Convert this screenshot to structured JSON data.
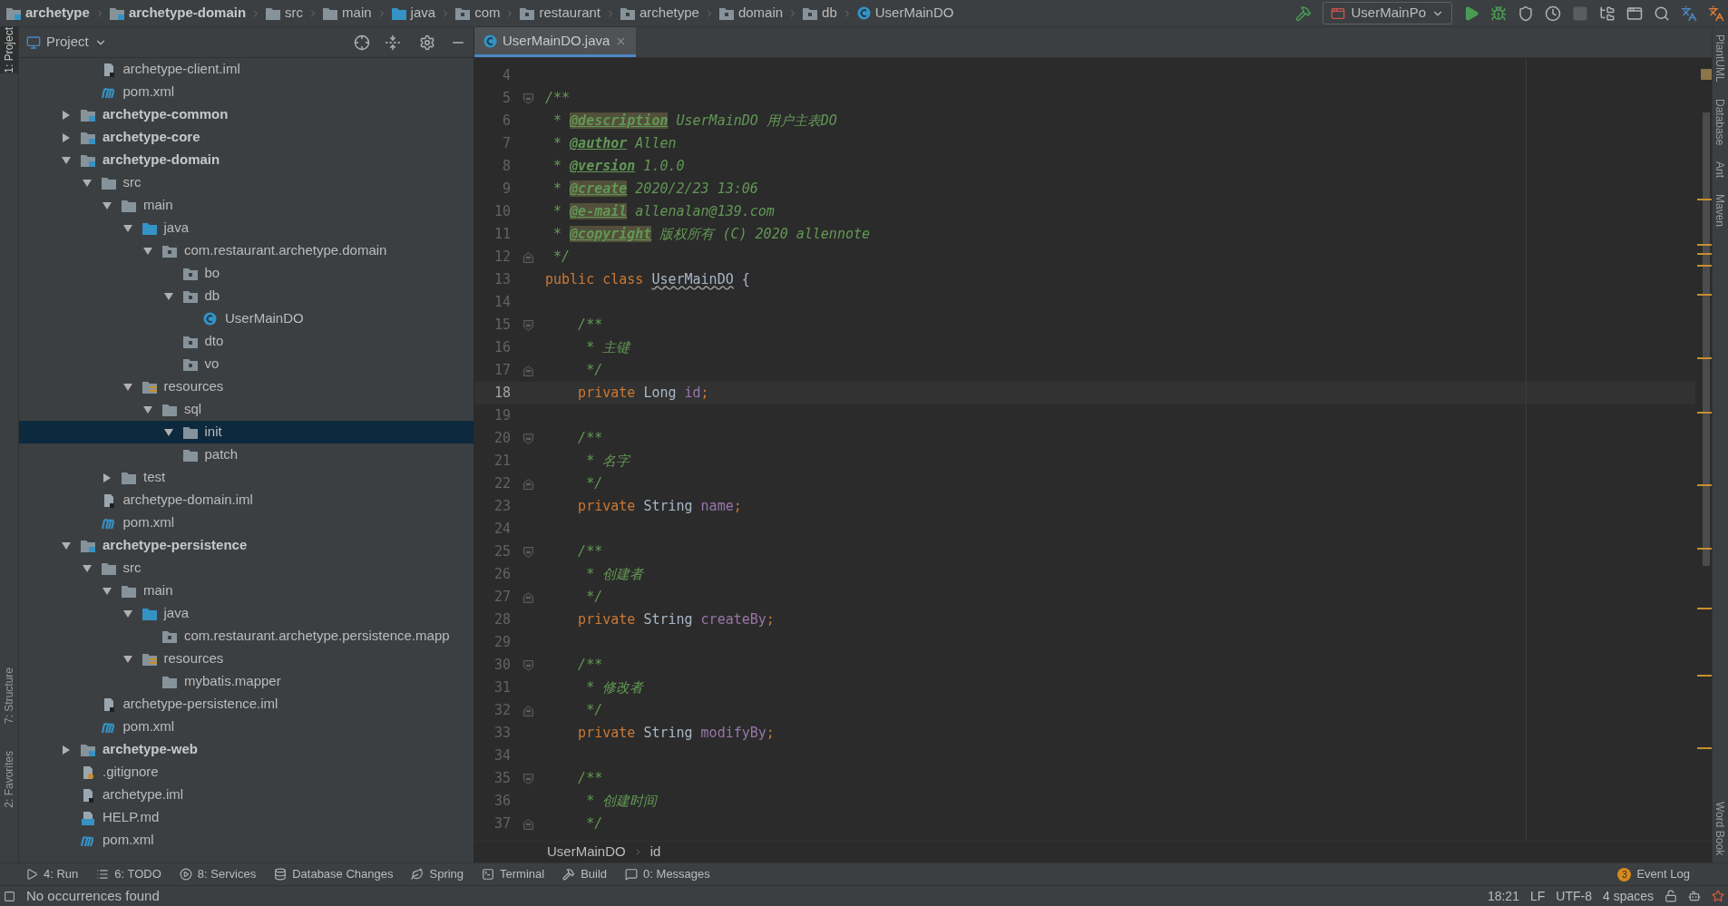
{
  "navbar": {
    "breadcrumbs": [
      {
        "label": "archetype",
        "kind": "module"
      },
      {
        "label": "archetype-domain",
        "kind": "module"
      },
      {
        "label": "src",
        "kind": "folder"
      },
      {
        "label": "main",
        "kind": "folder"
      },
      {
        "label": "java",
        "kind": "source"
      },
      {
        "label": "com",
        "kind": "package"
      },
      {
        "label": "restaurant",
        "kind": "package"
      },
      {
        "label": "archetype",
        "kind": "package"
      },
      {
        "label": "domain",
        "kind": "package"
      },
      {
        "label": "db",
        "kind": "package"
      },
      {
        "label": "UserMainDO",
        "kind": "class"
      }
    ],
    "run_config": "UserMainPo"
  },
  "left_tool_tabs": [
    {
      "label": "1: Project",
      "selected": true
    },
    {
      "label": "7: Structure",
      "selected": false
    },
    {
      "label": "2: Favorites",
      "selected": false
    }
  ],
  "right_tool_tabs": [
    "PlantUML",
    "Database",
    "Ant",
    "Maven",
    "Word Book"
  ],
  "project_panel": {
    "title": "Project",
    "tree": {
      "continued": [
        {
          "label": "archetype-client.iml",
          "kind": "iml"
        },
        {
          "label": "pom.xml",
          "kind": "maven"
        }
      ],
      "items": [
        {
          "label": "archetype-common",
          "kind": "module",
          "expanded": false
        },
        {
          "label": "archetype-core",
          "kind": "module",
          "expanded": false
        },
        {
          "label": "archetype-domain",
          "kind": "module",
          "expanded": true,
          "children": [
            {
              "label": "src",
              "kind": "folder",
              "expanded": true,
              "children": [
                {
                  "label": "main",
                  "kind": "folder",
                  "expanded": true,
                  "children": [
                    {
                      "label": "java",
                      "kind": "source",
                      "expanded": true,
                      "children": [
                        {
                          "label": "com.restaurant.archetype.domain",
                          "kind": "package",
                          "expanded": true,
                          "children": [
                            {
                              "label": "bo",
                              "kind": "package"
                            },
                            {
                              "label": "db",
                              "kind": "package",
                              "expanded": true,
                              "children": [
                                {
                                  "label": "UserMainDO",
                                  "kind": "class"
                                }
                              ]
                            },
                            {
                              "label": "dto",
                              "kind": "package"
                            },
                            {
                              "label": "vo",
                              "kind": "package"
                            }
                          ]
                        }
                      ]
                    },
                    {
                      "label": "resources",
                      "kind": "resources",
                      "expanded": true,
                      "children": [
                        {
                          "label": "sql",
                          "kind": "folder",
                          "expanded": true,
                          "children": [
                            {
                              "label": "init",
                              "kind": "folder",
                              "expanded": true,
                              "selected": true
                            },
                            {
                              "label": "patch",
                              "kind": "folder"
                            }
                          ]
                        }
                      ]
                    }
                  ]
                },
                {
                  "label": "test",
                  "kind": "folder",
                  "expanded": false
                }
              ]
            },
            {
              "label": "archetype-domain.iml",
              "kind": "iml"
            },
            {
              "label": "pom.xml",
              "kind": "maven"
            }
          ]
        },
        {
          "label": "archetype-persistence",
          "kind": "module",
          "expanded": true,
          "children": [
            {
              "label": "src",
              "kind": "folder",
              "expanded": true,
              "children": [
                {
                  "label": "main",
                  "kind": "folder",
                  "expanded": true,
                  "children": [
                    {
                      "label": "java",
                      "kind": "source",
                      "expanded": true,
                      "children": [
                        {
                          "label": "com.restaurant.archetype.persistence.mapp",
                          "kind": "package"
                        }
                      ]
                    },
                    {
                      "label": "resources",
                      "kind": "resources",
                      "expanded": true,
                      "children": [
                        {
                          "label": "mybatis.mapper",
                          "kind": "folder"
                        }
                      ]
                    }
                  ]
                }
              ]
            },
            {
              "label": "archetype-persistence.iml",
              "kind": "iml"
            },
            {
              "label": "pom.xml",
              "kind": "maven"
            }
          ]
        },
        {
          "label": "archetype-web",
          "kind": "module",
          "expanded": false
        },
        {
          "label": ".gitignore",
          "kind": "git"
        },
        {
          "label": "archetype.iml",
          "kind": "iml"
        },
        {
          "label": "HELP.md",
          "kind": "md"
        },
        {
          "label": "pom.xml",
          "kind": "maven"
        }
      ]
    }
  },
  "editor": {
    "tabs": [
      {
        "label": "UserMainDO.java",
        "selected": true
      }
    ],
    "lines": [
      {
        "number": "4",
        "current": false,
        "kind": "code"
      },
      {
        "number": "5",
        "current": false,
        "kind": "fold-start",
        "segments": [
          {
            "text": "/**",
            "kind": "comment"
          }
        ]
      },
      {
        "number": "6",
        "current": false,
        "segments": [
          {
            "text": " * ",
            "kind": "comment"
          },
          {
            "text": "@description",
            "kind": "tag",
            "highlighted": true
          },
          {
            "text": " UserMainDO 用户主表DO",
            "kind": "comment"
          }
        ]
      },
      {
        "number": "7",
        "current": false,
        "segments": [
          {
            "text": " * ",
            "kind": "comment"
          },
          {
            "text": "@author",
            "kind": "tag",
            "highlighted": false
          },
          {
            "text": " Allen",
            "kind": "comment"
          }
        ]
      },
      {
        "number": "8",
        "current": false,
        "segments": [
          {
            "text": " * ",
            "kind": "comment"
          },
          {
            "text": "@version",
            "kind": "tag",
            "highlighted": false
          },
          {
            "text": " 1.0.0",
            "kind": "comment"
          }
        ]
      },
      {
        "number": "9",
        "current": false,
        "segments": [
          {
            "text": " * ",
            "kind": "comment"
          },
          {
            "text": "@create",
            "kind": "tag",
            "highlighted": true
          },
          {
            "text": " 2020/2/23 13:06",
            "kind": "comment"
          }
        ]
      },
      {
        "number": "10",
        "current": false,
        "segments": [
          {
            "text": " * ",
            "kind": "comment"
          },
          {
            "text": "@e-mail",
            "kind": "tag",
            "highlighted": true
          },
          {
            "text": " allenalan@139.com",
            "kind": "comment"
          }
        ]
      },
      {
        "number": "11",
        "current": false,
        "segments": [
          {
            "text": " * ",
            "kind": "comment"
          },
          {
            "text": "@copyright",
            "kind": "tag",
            "highlighted": true
          },
          {
            "text": " 版权所有 (C) 2020 allennote",
            "kind": "comment"
          }
        ]
      },
      {
        "number": "12",
        "current": false,
        "kind": "fold-end",
        "segments": [
          {
            "text": " */",
            "kind": "comment"
          }
        ]
      },
      {
        "number": "13",
        "current": false,
        "segments": [
          {
            "text": "public class ",
            "kind": "keyword"
          },
          {
            "text": "UserMainDO",
            "kind": "classname"
          },
          {
            "text": " {",
            "kind": "plain"
          }
        ]
      },
      {
        "number": "14",
        "current": false,
        "kind": "code"
      },
      {
        "number": "15",
        "current": false,
        "kind": "fold-start",
        "segments": [
          {
            "text": "    /**",
            "kind": "comment"
          }
        ]
      },
      {
        "number": "16",
        "current": false,
        "segments": [
          {
            "text": "     * 主键",
            "kind": "comment"
          }
        ]
      },
      {
        "number": "17",
        "current": false,
        "kind": "fold-end",
        "segments": [
          {
            "text": "     */",
            "kind": "comment"
          }
        ]
      },
      {
        "number": "18",
        "current": true,
        "segments": [
          {
            "text": "    private ",
            "kind": "keyword"
          },
          {
            "text": "Long ",
            "kind": "plain"
          },
          {
            "text": "id",
            "kind": "field"
          },
          {
            "text": ";",
            "kind": "keyword"
          }
        ]
      },
      {
        "number": "19",
        "current": false,
        "kind": "code"
      },
      {
        "number": "20",
        "current": false,
        "kind": "fold-start",
        "segments": [
          {
            "text": "    /**",
            "kind": "comment"
          }
        ]
      },
      {
        "number": "21",
        "current": false,
        "segments": [
          {
            "text": "     * 名字",
            "kind": "comment"
          }
        ]
      },
      {
        "number": "22",
        "current": false,
        "kind": "fold-end",
        "segments": [
          {
            "text": "     */",
            "kind": "comment"
          }
        ]
      },
      {
        "number": "23",
        "current": false,
        "segments": [
          {
            "text": "    private ",
            "kind": "keyword"
          },
          {
            "text": "String ",
            "kind": "plain"
          },
          {
            "text": "name",
            "kind": "field"
          },
          {
            "text": ";",
            "kind": "keyword"
          }
        ]
      },
      {
        "number": "24",
        "current": false,
        "kind": "code"
      },
      {
        "number": "25",
        "current": false,
        "kind": "fold-start",
        "segments": [
          {
            "text": "    /**",
            "kind": "comment"
          }
        ]
      },
      {
        "number": "26",
        "current": false,
        "segments": [
          {
            "text": "     * 创建者",
            "kind": "comment"
          }
        ]
      },
      {
        "number": "27",
        "current": false,
        "kind": "fold-end",
        "segments": [
          {
            "text": "     */",
            "kind": "comment"
          }
        ]
      },
      {
        "number": "28",
        "current": false,
        "segments": [
          {
            "text": "    private ",
            "kind": "keyword"
          },
          {
            "text": "String ",
            "kind": "plain"
          },
          {
            "text": "createBy",
            "kind": "field"
          },
          {
            "text": ";",
            "kind": "keyword"
          }
        ]
      },
      {
        "number": "29",
        "current": false,
        "kind": "code"
      },
      {
        "number": "30",
        "current": false,
        "kind": "fold-start",
        "segments": [
          {
            "text": "    /**",
            "kind": "comment"
          }
        ]
      },
      {
        "number": "31",
        "current": false,
        "segments": [
          {
            "text": "     * 修改者",
            "kind": "comment"
          }
        ]
      },
      {
        "number": "32",
        "current": false,
        "kind": "fold-end",
        "segments": [
          {
            "text": "     */",
            "kind": "comment"
          }
        ]
      },
      {
        "number": "33",
        "current": false,
        "segments": [
          {
            "text": "    private ",
            "kind": "keyword"
          },
          {
            "text": "String ",
            "kind": "plain"
          },
          {
            "text": "modifyBy",
            "kind": "field"
          },
          {
            "text": ";",
            "kind": "keyword"
          }
        ]
      },
      {
        "number": "34",
        "current": false,
        "kind": "code"
      },
      {
        "number": "35",
        "current": false,
        "kind": "fold-start",
        "segments": [
          {
            "text": "    /**",
            "kind": "comment"
          }
        ]
      },
      {
        "number": "36",
        "current": false,
        "segments": [
          {
            "text": "     * 创建时间",
            "kind": "comment"
          }
        ]
      },
      {
        "number": "37",
        "current": false,
        "kind": "fold-end",
        "segments": [
          {
            "text": "     */",
            "kind": "comment"
          }
        ]
      }
    ],
    "breadcrumbs": [
      "UserMainDO",
      "id"
    ]
  },
  "tool_bar": {
    "items": [
      {
        "label": "4: Run",
        "kind": "run"
      },
      {
        "label": "6: TODO",
        "kind": "todo"
      },
      {
        "label": "8: Services",
        "kind": "services"
      },
      {
        "label": "Database Changes",
        "kind": "database"
      },
      {
        "label": "Spring",
        "kind": "spring"
      },
      {
        "label": "Terminal",
        "kind": "terminal"
      },
      {
        "label": "Build",
        "kind": "build"
      },
      {
        "label": "0: Messages",
        "kind": "messages"
      }
    ],
    "event_log": {
      "label": "Event Log",
      "count": "3"
    }
  },
  "status_bar": {
    "message": "No occurrences found",
    "items": [
      "18:21",
      "LF",
      "UTF-8",
      "4 spaces"
    ]
  }
}
